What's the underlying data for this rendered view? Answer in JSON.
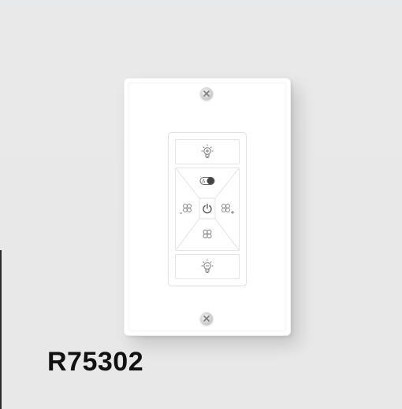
{
  "product": {
    "model_number": "R75302"
  },
  "remote": {
    "buttons": [
      {
        "name": "light-up",
        "icon": "bulb-plus-icon"
      },
      {
        "name": "toggle",
        "icon": "toggle-switch-icon"
      },
      {
        "name": "fan-left",
        "icon": "fan-minus-icon"
      },
      {
        "name": "power",
        "icon": "power-icon"
      },
      {
        "name": "fan-right",
        "icon": "fan-plus-icon"
      },
      {
        "name": "fan-center",
        "icon": "fan-icon"
      },
      {
        "name": "light-down",
        "icon": "bulb-minus-icon"
      }
    ]
  },
  "colors": {
    "background": "#e9e9e9",
    "plate": "#ffffff",
    "icon": "#777777",
    "text": "#111111"
  }
}
